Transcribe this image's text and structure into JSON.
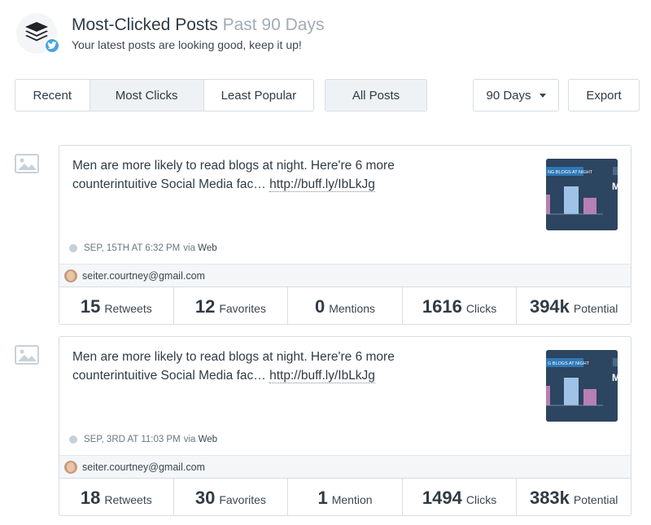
{
  "header": {
    "title": "Most-Clicked Posts",
    "title_period": "Past 90 Days",
    "subtitle": "Your latest posts are looking good, keep it up!",
    "logo_icon": "buffer-stack-icon",
    "badge_icon": "twitter-bird-icon",
    "badge_color": "#4aa3df"
  },
  "toolbar": {
    "tabs": [
      {
        "label": "Recent",
        "active": false
      },
      {
        "label": "Most Clicks",
        "active": true
      },
      {
        "label": "Least Popular",
        "active": false
      }
    ],
    "filter_label": "All Posts",
    "range_label": "90 Days",
    "export_label": "Export"
  },
  "posts": [
    {
      "text": "Men are more likely to read blogs at night. Here're 6 more counterintuitive Social Media fac…",
      "link": "http://buff.ly/IbLkJg",
      "date": "SEP, 15TH AT 6:32 PM",
      "via_prefix": "via",
      "via": "Web",
      "thumb_caption": "NG BLOGS AT NIGHT",
      "account": "seiter.courtney@gmail.com",
      "stats": [
        {
          "value": "15",
          "label": "Retweets"
        },
        {
          "value": "12",
          "label": "Favorites"
        },
        {
          "value": "0",
          "label": "Mentions"
        },
        {
          "value": "1616",
          "label": "Clicks"
        },
        {
          "value": "394k",
          "label": "Potential"
        }
      ]
    },
    {
      "text": "Men are more likely to read blogs at night. Here're 6 more counterintuitive Social Media fac…",
      "link": "http://buff.ly/IbLkJg",
      "date": "SEP, 3RD AT 11:03 PM",
      "via_prefix": "via",
      "via": "Web",
      "thumb_caption": "G BLOGS AT NIGHT",
      "account": "seiter.courtney@gmail.com",
      "stats": [
        {
          "value": "18",
          "label": "Retweets"
        },
        {
          "value": "30",
          "label": "Favorites"
        },
        {
          "value": "1",
          "label": "Mention"
        },
        {
          "value": "1494",
          "label": "Clicks"
        },
        {
          "value": "383k",
          "label": "Potential"
        }
      ]
    }
  ]
}
